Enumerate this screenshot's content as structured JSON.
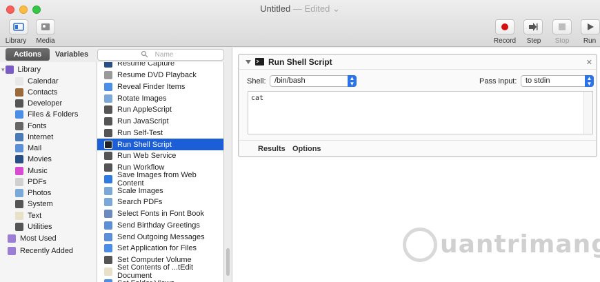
{
  "window": {
    "title": "Untitled",
    "status": "— Edited ⌄"
  },
  "toolbar": {
    "library_label": "Library",
    "media_label": "Media",
    "record_label": "Record",
    "step_label": "Step",
    "stop_label": "Stop",
    "run_label": "Run"
  },
  "sidebar": {
    "tabs": [
      {
        "label": "Actions"
      },
      {
        "label": "Variables"
      }
    ],
    "search_placeholder": "Name",
    "library_items": [
      {
        "label": "Library",
        "icon": "library-icon",
        "color": "#7b5cc6"
      },
      {
        "label": "Calendar",
        "icon": "calendar-icon",
        "color": "#e8e8e8"
      },
      {
        "label": "Contacts",
        "icon": "contacts-icon",
        "color": "#9a6a3a"
      },
      {
        "label": "Developer",
        "icon": "developer-icon",
        "color": "#555555"
      },
      {
        "label": "Files & Folders",
        "icon": "finder-icon",
        "color": "#4a8ee6"
      },
      {
        "label": "Fonts",
        "icon": "fonts-icon",
        "color": "#666666"
      },
      {
        "label": "Internet",
        "icon": "internet-icon",
        "color": "#4b7ab8"
      },
      {
        "label": "Mail",
        "icon": "mail-icon",
        "color": "#5b8fd8"
      },
      {
        "label": "Movies",
        "icon": "movies-icon",
        "color": "#2a4f86"
      },
      {
        "label": "Music",
        "icon": "music-icon",
        "color": "#d84ad0"
      },
      {
        "label": "PDFs",
        "icon": "pdf-icon",
        "color": "#d0d0d0"
      },
      {
        "label": "Photos",
        "icon": "photos-icon",
        "color": "#7aa8d8"
      },
      {
        "label": "System",
        "icon": "system-icon",
        "color": "#555555"
      },
      {
        "label": "Text",
        "icon": "text-icon",
        "color": "#e8e0c8"
      },
      {
        "label": "Utilities",
        "icon": "utilities-icon",
        "color": "#555555"
      },
      {
        "label": "Most Used",
        "icon": "smart-folder-icon",
        "color": "#9b7fd6"
      },
      {
        "label": "Recently Added",
        "icon": "smart-folder-icon",
        "color": "#9b7fd6"
      }
    ]
  },
  "actions": {
    "items": [
      {
        "label": "Resume Capture",
        "icon": "camera-icon",
        "color": "#2a4f86"
      },
      {
        "label": "Resume DVD Playback",
        "icon": "dvd-icon",
        "color": "#9a9a9a"
      },
      {
        "label": "Reveal Finder Items",
        "icon": "finder-icon",
        "color": "#4a8ee6"
      },
      {
        "label": "Rotate Images",
        "icon": "preview-icon",
        "color": "#7aa8d8"
      },
      {
        "label": "Run AppleScript",
        "icon": "script-icon",
        "color": "#555555"
      },
      {
        "label": "Run JavaScript",
        "icon": "script-icon",
        "color": "#555555"
      },
      {
        "label": "Run Self-Test",
        "icon": "developer-icon",
        "color": "#555555"
      },
      {
        "label": "Run Shell Script",
        "icon": "terminal-icon",
        "color": "#222222",
        "selected": true
      },
      {
        "label": "Run Web Service",
        "icon": "script-icon",
        "color": "#555555"
      },
      {
        "label": "Run Workflow",
        "icon": "automator-icon",
        "color": "#555555"
      },
      {
        "label": "Save Images from Web Content",
        "icon": "safari-icon",
        "color": "#2f7be0"
      },
      {
        "label": "Scale Images",
        "icon": "preview-icon",
        "color": "#7aa8d8"
      },
      {
        "label": "Search PDFs",
        "icon": "preview-icon",
        "color": "#7aa8d8"
      },
      {
        "label": "Select Fonts in Font Book",
        "icon": "fontbook-icon",
        "color": "#6a8ac0"
      },
      {
        "label": "Send Birthday Greetings",
        "icon": "mail-icon",
        "color": "#5b8fd8"
      },
      {
        "label": "Send Outgoing Messages",
        "icon": "mail-icon",
        "color": "#5b8fd8"
      },
      {
        "label": "Set Application for Files",
        "icon": "finder-icon",
        "color": "#4a8ee6"
      },
      {
        "label": "Set Computer Volume",
        "icon": "volume-icon",
        "color": "#555555"
      },
      {
        "label": "Set Contents of ...tEdit Document",
        "icon": "textedit-icon",
        "color": "#e8e0c8"
      },
      {
        "label": "Set Folder Views",
        "icon": "finder-icon",
        "color": "#4a8ee6"
      }
    ]
  },
  "workflow_action": {
    "title": "Run Shell Script",
    "shell_label": "Shell:",
    "shell_value": "/bin/bash",
    "pass_input_label": "Pass input:",
    "pass_input_value": "to stdin",
    "script_text": "cat",
    "tabs": [
      {
        "label": "Results"
      },
      {
        "label": "Options"
      }
    ]
  },
  "watermark": {
    "text": "uantrimang"
  }
}
